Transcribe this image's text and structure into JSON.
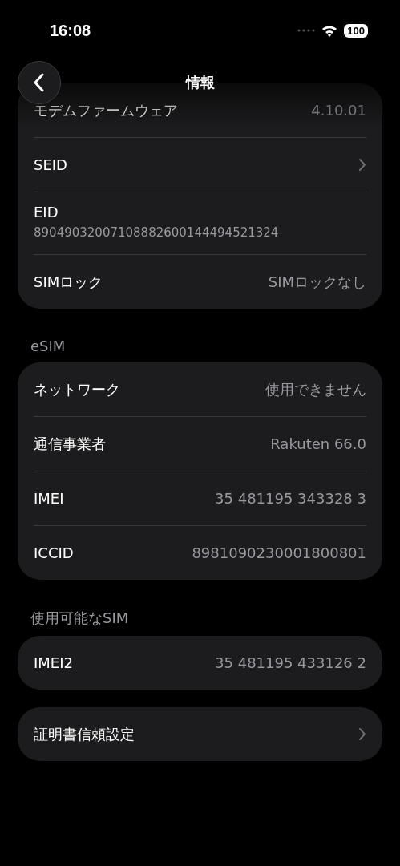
{
  "status_bar": {
    "time": "16:08",
    "battery": "100"
  },
  "nav": {
    "title": "情報"
  },
  "sections": [
    {
      "rows": [
        {
          "kind": "value",
          "label": "モデムファームウェア",
          "value": "4.10.01"
        },
        {
          "kind": "link",
          "label": "SEID"
        },
        {
          "kind": "stacked",
          "label": "EID",
          "value": "89049032007108882600144494521324"
        },
        {
          "kind": "value",
          "label": "SIMロック",
          "value": "SIMロックなし"
        }
      ]
    },
    {
      "header": "eSIM",
      "rows": [
        {
          "kind": "value",
          "label": "ネットワーク",
          "value": "使用できません"
        },
        {
          "kind": "value",
          "label": "通信事業者",
          "value": "Rakuten 66.0"
        },
        {
          "kind": "value",
          "label": "IMEI",
          "value": "35 481195 343328 3"
        },
        {
          "kind": "value",
          "label": "ICCID",
          "value": "8981090230001800801"
        }
      ]
    },
    {
      "header": "使用可能なSIM",
      "rows": [
        {
          "kind": "value",
          "label": "IMEI2",
          "value": "35 481195 433126 2"
        }
      ]
    },
    {
      "rows": [
        {
          "kind": "link",
          "label": "証明書信頼設定"
        }
      ]
    }
  ]
}
